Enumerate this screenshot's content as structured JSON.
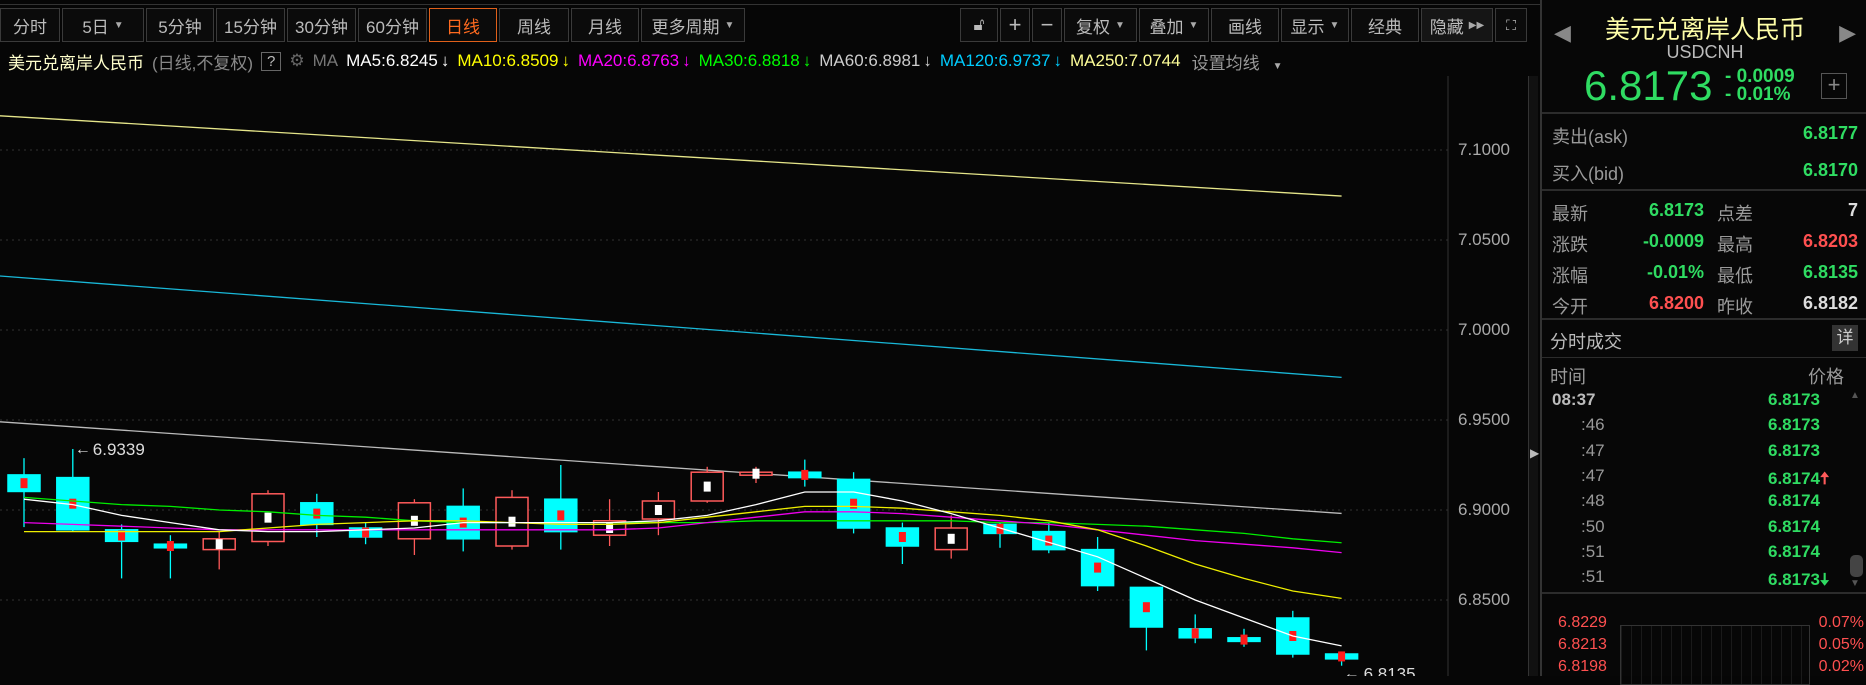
{
  "toolbar": {
    "periods": [
      {
        "label": "分时"
      },
      {
        "label": "5日",
        "dropdown": true
      },
      {
        "label": "5分钟"
      },
      {
        "label": "15分钟"
      },
      {
        "label": "30分钟"
      },
      {
        "label": "60分钟"
      },
      {
        "label": "日线",
        "active": true
      },
      {
        "label": "周线"
      },
      {
        "label": "月线"
      },
      {
        "label": "更多周期",
        "dropdown": true
      }
    ],
    "tools": {
      "plus": "+",
      "minus": "−",
      "fuquan": "复权",
      "overlay": "叠加",
      "draw": "画线",
      "display": "显示",
      "classic": "经典",
      "hide": "隐藏"
    }
  },
  "ma_row": {
    "name": "美元兑离岸人民币",
    "mode": "(日线,不复权)",
    "help": "?",
    "ma_label": "MA",
    "items": [
      {
        "text": "MA5:6.8245",
        "arrow": "↓",
        "color": "#ffffff"
      },
      {
        "text": "MA10:6.8509",
        "arrow": "↓",
        "color": "#ffff00"
      },
      {
        "text": "MA20:6.8763",
        "arrow": "↓",
        "color": "#ff00ff"
      },
      {
        "text": "MA30:6.8818",
        "arrow": "↓",
        "color": "#00ff00"
      },
      {
        "text": "MA60:6.8981",
        "arrow": "↓",
        "color": "#cccccc"
      },
      {
        "text": "MA120:6.9737",
        "arrow": "↓",
        "color": "#00ccff"
      },
      {
        "text": "MA250:7.0744",
        "arrow": "",
        "color": "#ffff99"
      }
    ],
    "settings": "设置均线"
  },
  "chart_data": {
    "type": "candlestick",
    "ylim": [
      6.81,
      7.14
    ],
    "yticks": [
      "7.1000",
      "7.0500",
      "7.0000",
      "6.9500",
      "6.9000",
      "6.8500"
    ],
    "ytick_values": [
      7.1,
      7.05,
      7.0,
      6.95,
      6.9,
      6.85
    ],
    "up_color": "#ff5a5a",
    "down_color": "#00ffff",
    "candles": [
      [
        6.9195,
        6.9288,
        6.8905,
        6.9103
      ],
      [
        6.918,
        6.9339,
        6.888,
        6.889
      ],
      [
        6.889,
        6.892,
        6.862,
        6.8826
      ],
      [
        6.881,
        6.886,
        6.862,
        6.879
      ],
      [
        6.878,
        6.888,
        6.867,
        6.884
      ],
      [
        6.8825,
        6.911,
        6.88,
        6.909
      ],
      [
        6.904,
        6.909,
        6.885,
        6.892
      ],
      [
        6.89,
        6.893,
        6.881,
        6.885
      ],
      [
        6.884,
        6.906,
        6.875,
        6.904
      ],
      [
        6.902,
        6.912,
        6.877,
        6.884
      ],
      [
        6.88,
        6.911,
        6.878,
        6.907
      ],
      [
        6.906,
        6.925,
        6.878,
        6.888
      ],
      [
        6.886,
        6.906,
        6.88,
        6.894
      ],
      [
        6.895,
        6.91,
        6.886,
        6.905
      ],
      [
        6.905,
        6.924,
        6.904,
        6.921
      ],
      [
        6.92,
        6.924,
        6.915,
        6.921
      ],
      [
        6.921,
        6.928,
        6.913,
        6.918
      ],
      [
        6.917,
        6.921,
        6.887,
        6.89
      ],
      [
        6.89,
        6.893,
        6.87,
        6.88
      ],
      [
        6.878,
        6.897,
        6.873,
        6.89
      ],
      [
        6.892,
        6.893,
        6.879,
        6.887
      ],
      [
        6.888,
        6.893,
        6.876,
        6.878
      ],
      [
        6.878,
        6.885,
        6.855,
        6.858
      ],
      [
        6.857,
        6.857,
        6.822,
        6.835
      ],
      [
        6.834,
        6.842,
        6.826,
        6.829
      ],
      [
        6.829,
        6.834,
        6.824,
        6.827
      ],
      [
        6.84,
        6.844,
        6.818,
        6.82
      ],
      [
        6.82,
        6.8203,
        6.8135,
        6.8173
      ]
    ],
    "ma5": [
      6.906,
      6.903,
      6.897,
      6.893,
      6.889,
      6.888,
      6.888,
      6.889,
      6.89,
      6.893,
      6.893,
      6.893,
      6.893,
      6.894,
      6.897,
      6.903,
      6.91,
      6.91,
      6.905,
      6.898,
      6.89,
      6.882,
      6.874,
      6.862,
      6.85,
      6.84,
      6.83,
      6.8245
    ],
    "ma10": [
      6.888,
      6.888,
      6.888,
      6.888,
      6.888,
      6.89,
      6.892,
      6.893,
      6.894,
      6.894,
      6.893,
      6.892,
      6.892,
      6.893,
      6.896,
      6.899,
      6.902,
      6.902,
      6.901,
      6.899,
      6.897,
      6.894,
      6.889,
      6.88,
      6.87,
      6.862,
      6.855,
      6.8509
    ],
    "ma20": [
      6.893,
      6.892,
      6.891,
      6.89,
      6.889,
      6.889,
      6.889,
      6.889,
      6.889,
      6.889,
      6.889,
      6.889,
      6.889,
      6.89,
      6.893,
      6.896,
      6.899,
      6.899,
      6.898,
      6.896,
      6.894,
      6.892,
      6.889,
      6.886,
      6.883,
      6.881,
      6.879,
      6.8763
    ],
    "ma30": [
      6.907,
      6.905,
      6.903,
      6.902,
      6.9,
      6.899,
      6.897,
      6.896,
      6.894,
      6.893,
      6.893,
      6.893,
      6.893,
      6.893,
      6.893,
      6.894,
      6.894,
      6.894,
      6.894,
      6.894,
      6.893,
      6.893,
      6.892,
      6.891,
      6.889,
      6.887,
      6.884,
      6.8818
    ],
    "ma60_range": [
      6.949,
      6.8981
    ],
    "ma120_range": [
      7.03,
      6.9737
    ],
    "ma250_range": [
      7.119,
      7.0744
    ],
    "high_label": "6.9339",
    "low_label": "6.8135"
  },
  "panel": {
    "title": "美元兑离岸人民币",
    "code": "USDCNH",
    "price": "6.8173",
    "change": "- 0.0009",
    "change_pct": "- 0.01%",
    "ask_label": "卖出(ask)",
    "ask": "6.8177",
    "bid_label": "买入(bid)",
    "bid": "6.8170",
    "stats": [
      {
        "l1": "最新",
        "v1": "6.8173",
        "c1": "g",
        "l2": "点差",
        "v2": "7",
        "c2": "w"
      },
      {
        "l1": "涨跌",
        "v1": "-0.0009",
        "c1": "g",
        "l2": "最高",
        "v2": "6.8203",
        "c2": "r"
      },
      {
        "l1": "涨幅",
        "v1": "-0.01%",
        "c1": "g",
        "l2": "最低",
        "v2": "6.8135",
        "c2": "g"
      },
      {
        "l1": "今开",
        "v1": "6.8200",
        "c1": "r",
        "l2": "昨收",
        "v2": "6.8182",
        "c2": "w"
      }
    ],
    "ticks_title": "分时成交",
    "detail": "详",
    "col_time": "时间",
    "col_price": "价格",
    "ticks": [
      {
        "time": "08:37",
        "price": "6.8173",
        "dir": ""
      },
      {
        "time": ":46",
        "price": "6.8173",
        "dir": ""
      },
      {
        "time": ":47",
        "price": "6.8173",
        "dir": ""
      },
      {
        "time": ":47",
        "price": "6.8174",
        "dir": "up"
      },
      {
        "time": ":48",
        "price": "6.8174",
        "dir": ""
      },
      {
        "time": ":50",
        "price": "6.8174",
        "dir": ""
      },
      {
        "time": ":51",
        "price": "6.8174",
        "dir": ""
      },
      {
        "time": ":51",
        "price": "6.8173",
        "dir": "down"
      }
    ],
    "mini": [
      {
        "p": "6.8229",
        "pct": "0.07%"
      },
      {
        "p": "6.8213",
        "pct": "0.05%"
      },
      {
        "p": "6.8198",
        "pct": "0.02%"
      }
    ]
  }
}
